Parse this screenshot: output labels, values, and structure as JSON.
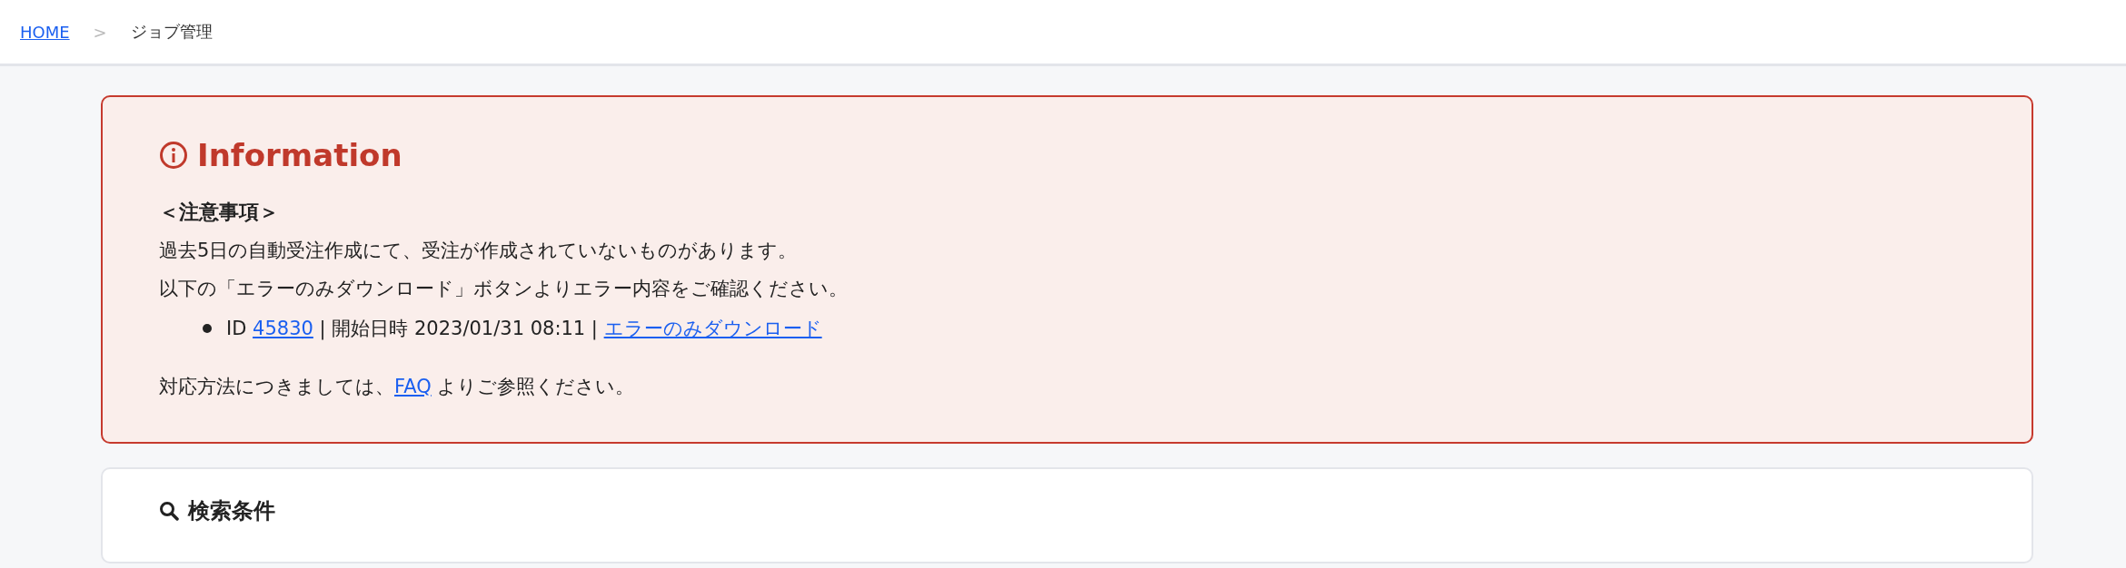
{
  "breadcrumb": {
    "items": [
      {
        "kind": "link",
        "text": "HOME"
      },
      {
        "kind": "current",
        "text": "ジョブ管理"
      }
    ],
    "separator": ">"
  },
  "information": {
    "title": "Information",
    "heading": "＜注意事項＞",
    "lines": [
      "過去5日の自動受注作成にて、受注が作成されていないものがあります。",
      "以下の「エラーのみダウンロード」ボタンよりエラー内容をご確認ください。"
    ],
    "jobs": [
      [
        {
          "kind": "text",
          "text": "ID "
        },
        {
          "kind": "link",
          "text": "45830"
        },
        {
          "kind": "text",
          "text": " | 開始日時 2023/01/31 08:11 | "
        },
        {
          "kind": "link",
          "text": "エラーのみダウンロード"
        }
      ]
    ],
    "footer": [
      {
        "kind": "text",
        "text": "対応方法につきましては、"
      },
      {
        "kind": "link",
        "text": "FAQ"
      },
      {
        "kind": "text",
        "text": " よりご参照ください。"
      }
    ]
  },
  "search": {
    "title": "検索条件"
  }
}
